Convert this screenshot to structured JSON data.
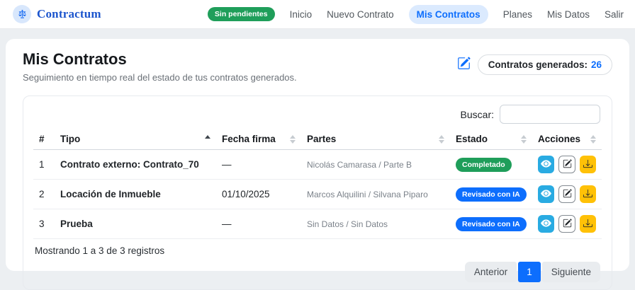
{
  "brand": {
    "name": "Contractum"
  },
  "navbar": {
    "pending_badge": "Sin pendientes",
    "items": [
      {
        "label": "Inicio",
        "active": false
      },
      {
        "label": "Nuevo Contrato",
        "active": false
      },
      {
        "label": "Mis Contratos",
        "active": true
      },
      {
        "label": "Planes",
        "active": false
      },
      {
        "label": "Mis Datos",
        "active": false
      },
      {
        "label": "Salir",
        "active": false
      }
    ]
  },
  "header": {
    "title": "Mis Contratos",
    "subtitle": "Seguimiento en tiempo real del estado de tus contratos generados.",
    "counter_label": "Contratos generados:",
    "counter_value": "26"
  },
  "table": {
    "search_label": "Buscar:",
    "search_value": "",
    "columns": [
      "#",
      "Tipo",
      "Fecha firma",
      "Partes",
      "Estado",
      "Acciones"
    ],
    "sorted_column": "Tipo",
    "sort_direction": "asc",
    "rows": [
      {
        "num": "1",
        "tipo": "Contrato externo: Contrato_70",
        "fecha": "—",
        "partes": "Nicolás Camarasa / Parte B",
        "estado": "Completado",
        "estado_color": "#1f9e5a"
      },
      {
        "num": "2",
        "tipo": "Locación de Inmueble",
        "fecha": "01/10/2025",
        "partes": "Marcos Alquilini / Silvana Piparo",
        "estado": "Revisado con IA",
        "estado_color": "#0d6efd"
      },
      {
        "num": "3",
        "tipo": "Prueba",
        "fecha": "—",
        "partes": "Sin Datos / Sin Datos",
        "estado": "Revisado con IA",
        "estado_color": "#0d6efd"
      }
    ],
    "info": "Mostrando 1 a 3 de 3 registros",
    "pagination": {
      "prev": "Anterior",
      "current": "1",
      "next": "Siguiente"
    }
  },
  "icons": {
    "brand": "scales-icon",
    "header": "file-edit-icon",
    "view": "eye-icon",
    "edit": "pencil-square-icon",
    "download": "download-icon"
  },
  "colors": {
    "primary": "#0d6efd",
    "success": "#1f9e5a",
    "info_button": "#29abe2",
    "warning_button": "#ffc107",
    "nav_active_bg": "#dbeafe",
    "brand_blue": "#1c55cd"
  }
}
